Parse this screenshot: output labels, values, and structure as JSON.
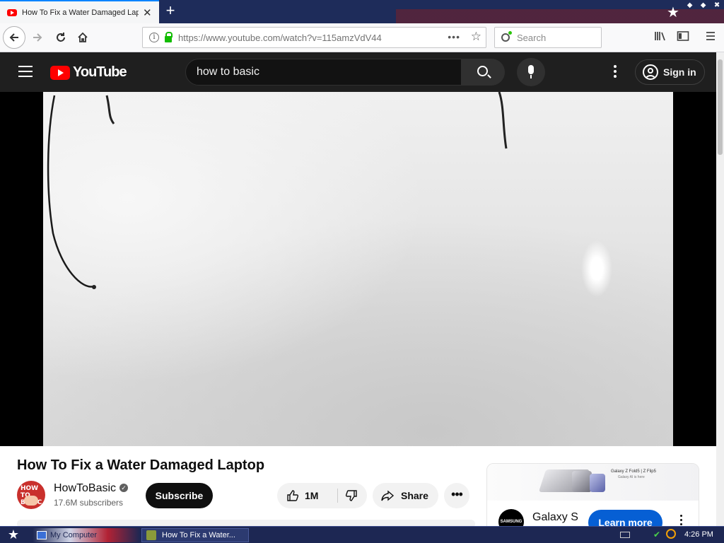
{
  "browser": {
    "tab": {
      "title": "How To Fix a Water Damaged Laptop"
    },
    "url": "https://www.youtube.com/watch?v=115amzVdV44",
    "search_placeholder": "Search"
  },
  "youtube": {
    "logo_text": "YouTube",
    "search_query": "how to basic",
    "sign_in_label": "Sign in"
  },
  "video": {
    "title": "How To Fix a Water Damaged Laptop",
    "channel": {
      "name": "HowToBasic",
      "avatar_text": "HOW TO BASIC",
      "subscribers": "17.6M subscribers"
    },
    "subscribe_label": "Subscribe",
    "like_count": "1M",
    "share_label": "Share"
  },
  "ad": {
    "banner_text": "Galaxy Z Fold5 | Z Flip5",
    "banner_subtext": "Galaxy AI is here",
    "brand_logo_text": "SAMSUNG",
    "title": "Galaxy S",
    "cta_label": "Learn more"
  },
  "taskbar": {
    "items": [
      {
        "label": "My Computer"
      },
      {
        "label": "How To Fix a Water..."
      }
    ],
    "clock": "4:26 PM"
  },
  "colors": {
    "youtube_red": "#ff0000",
    "masthead_bg": "#1f1f1f",
    "cta_blue": "#065fd4",
    "taskbar_bg": "#1d2753"
  }
}
